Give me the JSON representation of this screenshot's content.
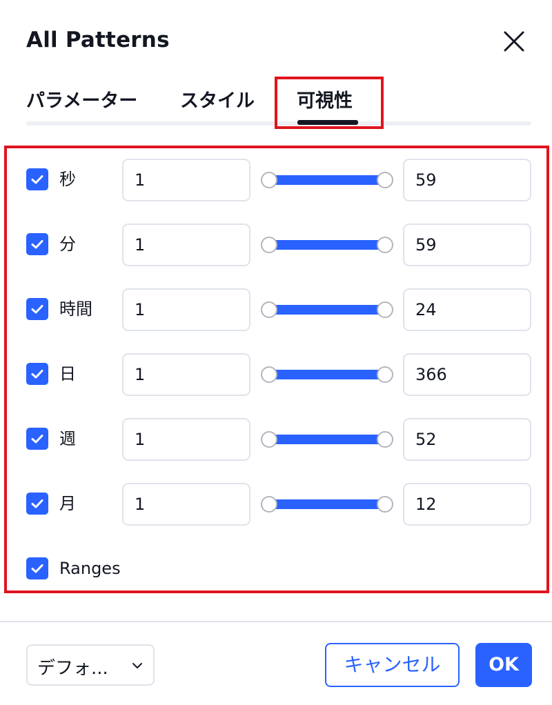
{
  "dialog": {
    "title": "All Patterns"
  },
  "tabs": [
    {
      "label": "パラメーター",
      "active": false
    },
    {
      "label": "スタイル",
      "active": false
    },
    {
      "label": "可視性",
      "active": true
    }
  ],
  "rows": [
    {
      "label": "秒",
      "checked": true,
      "min": "1",
      "max": "59"
    },
    {
      "label": "分",
      "checked": true,
      "min": "1",
      "max": "59"
    },
    {
      "label": "時間",
      "checked": true,
      "min": "1",
      "max": "24"
    },
    {
      "label": "日",
      "checked": true,
      "min": "1",
      "max": "366"
    },
    {
      "label": "週",
      "checked": true,
      "min": "1",
      "max": "52"
    },
    {
      "label": "月",
      "checked": true,
      "min": "1",
      "max": "12"
    }
  ],
  "ranges": {
    "label": "Ranges",
    "checked": true
  },
  "footer": {
    "template_select": "デフォ...",
    "cancel_label": "キャンセル",
    "ok_label": "OK"
  },
  "colors": {
    "accent": "#2962ff",
    "highlight": "#e0141e",
    "text": "#131722",
    "border": "#e0e3eb"
  },
  "icons": {
    "close": "close-icon",
    "check": "check-icon",
    "chevron": "chevron-down-icon"
  }
}
